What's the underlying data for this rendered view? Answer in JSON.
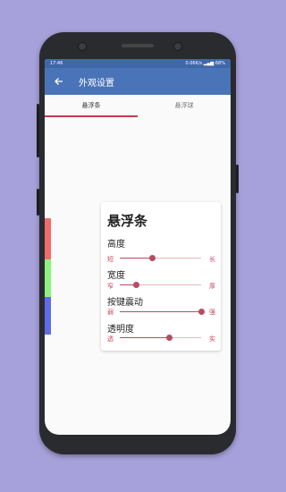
{
  "status_bar": {
    "time": "17:46",
    "network_speed": "0.06K/s",
    "battery": "68%"
  },
  "app_bar": {
    "title": "外观设置",
    "back_icon": "arrow-back-icon"
  },
  "tabs": [
    {
      "label": "悬浮条",
      "active": true
    },
    {
      "label": "悬浮球",
      "active": false
    }
  ],
  "color_strips": [
    "#f16b6b",
    "#8cf27f",
    "#5f6be8"
  ],
  "card": {
    "title": "悬浮条",
    "settings": [
      {
        "label": "高度",
        "min": "短",
        "max": "长",
        "value": 0.4
      },
      {
        "label": "宽度",
        "min": "窄",
        "max": "厚",
        "value": 0.2
      },
      {
        "label": "按键震动",
        "min": "弱",
        "max": "强",
        "value": 1.0
      },
      {
        "label": "透明度",
        "min": "透",
        "max": "实",
        "value": 0.6
      }
    ]
  },
  "colors": {
    "app_bar": "#4a74b8",
    "accent": "#c23b53",
    "background": "#a7a1db"
  }
}
